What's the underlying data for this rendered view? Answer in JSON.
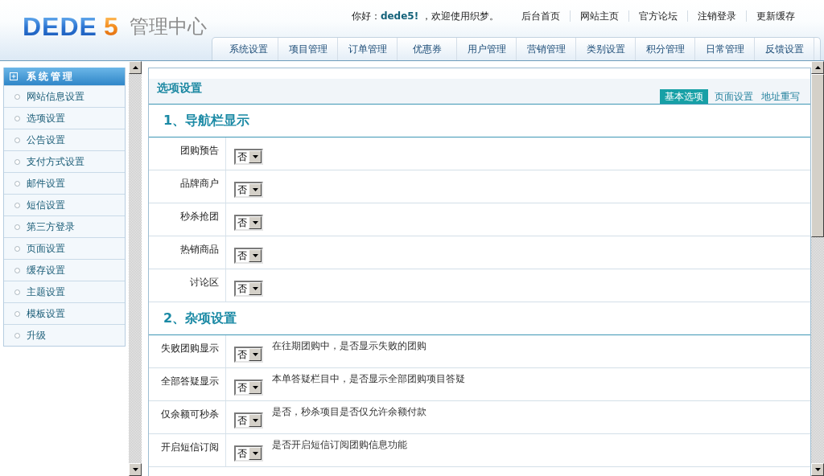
{
  "header": {
    "logo": {
      "wordmark": "DEDE",
      "number": "5"
    },
    "title": "管理中心",
    "greeting": "你好：**dede5!** ，欢迎使用织梦。",
    "links": [
      "后台首页",
      "网站主页",
      "官方论坛",
      "注销登录",
      "更新缓存"
    ]
  },
  "nav_tabs": [
    "系统设置",
    "项目管理",
    "订单管理",
    "优惠券",
    "用户管理",
    "营销管理",
    "类别设置",
    "积分管理",
    "日常管理",
    "反馈设置"
  ],
  "sidebar": {
    "title": "系统管理",
    "items": [
      "网站信息设置",
      "选项设置",
      "公告设置",
      "支付方式设置",
      "邮件设置",
      "短信设置",
      "第三方登录",
      "页面设置",
      "缓存设置",
      "主题设置",
      "模板设置",
      "升级"
    ]
  },
  "panel": {
    "title": "选项设置",
    "tabs": [
      {
        "label": "基本选项",
        "selected": true
      },
      {
        "label": "页面设置",
        "selected": false
      },
      {
        "label": "地址重写",
        "selected": false
      }
    ],
    "sections": [
      {
        "heading": "1、导航栏显示",
        "rows": [
          {
            "label": "团购预告",
            "value": "否"
          },
          {
            "label": "品牌商户",
            "value": "否"
          },
          {
            "label": "秒杀抢团",
            "value": "否"
          },
          {
            "label": "热销商品",
            "value": "否"
          },
          {
            "label": "讨论区",
            "value": "否"
          }
        ]
      },
      {
        "heading": "2、杂项设置",
        "rows": [
          {
            "label": "失败团购显示",
            "value": "否",
            "description": "在往期团购中，是否显示失败的团购"
          },
          {
            "label": "全部答疑显示",
            "value": "否",
            "description": "本单答疑栏目中，是否显示全部团购项目答疑"
          },
          {
            "label": "仅余额可秒杀",
            "value": "否",
            "description": "是否，秒杀项目是否仅允许余额付款"
          },
          {
            "label": "开启短信订阅",
            "value": "否",
            "description": "是否开启短信订阅团购信息功能"
          }
        ]
      }
    ]
  }
}
